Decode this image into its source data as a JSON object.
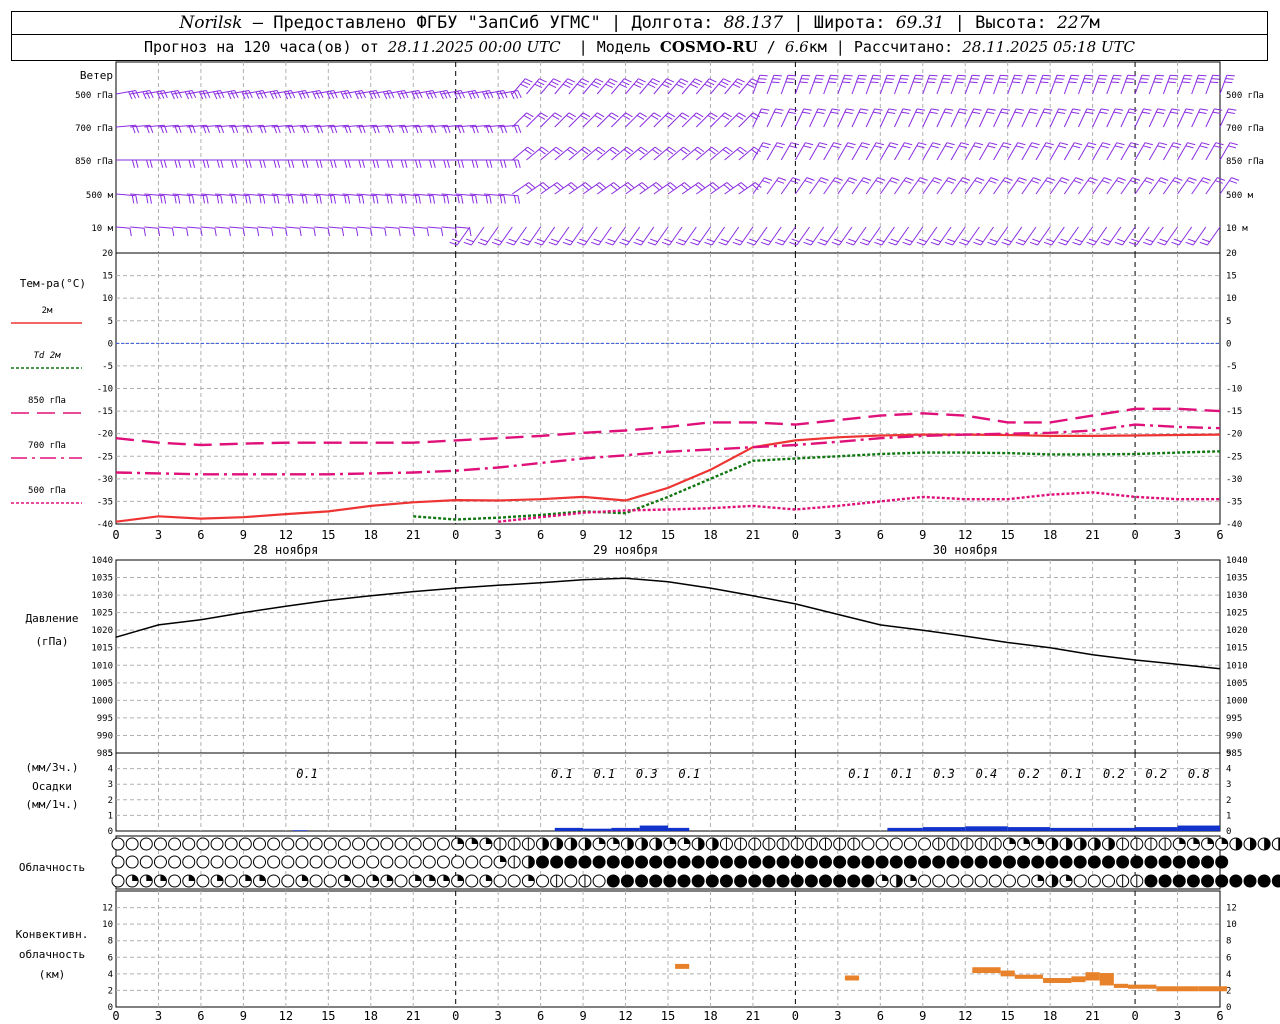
{
  "header": {
    "station": "Norilsk",
    "dash": "–",
    "provider": "Предоставлено ФГБУ \"ЗапСиб УГМС\"",
    "lon_label": "Долгота:",
    "lon": "88.137",
    "lat_label": "Широта:",
    "lat": "69.31",
    "alt_label": "Высота:",
    "alt": "227",
    "alt_unit": "м",
    "forecast_label": "Прогноз на 120 часа(ов) от",
    "forecast_start": "28.11.2025 00:00 UTC",
    "model_label": "Модель",
    "model": "COSMO-RU",
    "model_res": "6.6",
    "model_res_unit": "км",
    "computed_label": "Рассчитано:",
    "computed": "28.11.2025 05:18 UTC"
  },
  "chart_data": [
    {
      "type": "wind_barbs",
      "panel_label": "Ветер",
      "levels": [
        "500 гПа",
        "700 гПа",
        "850 гПа",
        "500 м",
        "10  м"
      ],
      "color": "#8a2be2"
    },
    {
      "type": "line",
      "panel_label": "Тем-ра(°C)",
      "ylim": [
        -40,
        20
      ],
      "yticks": [
        20,
        15,
        10,
        5,
        0,
        -5,
        -10,
        -15,
        -20,
        -25,
        -30,
        -35,
        -40
      ],
      "x_hours": [
        0,
        3,
        6,
        9,
        12,
        15,
        18,
        21,
        24,
        27,
        30,
        33,
        36,
        39,
        42,
        45,
        48,
        51,
        54,
        57,
        60,
        63,
        66,
        69,
        72,
        75,
        78
      ],
      "x_ticks": [
        "0",
        "3",
        "6",
        "9",
        "12",
        "15",
        "18",
        "21",
        "0",
        "3",
        "6",
        "9",
        "12",
        "15",
        "18",
        "21",
        "0",
        "3",
        "6",
        "9",
        "12",
        "15",
        "18",
        "21",
        "0",
        "3",
        "6"
      ],
      "dates": [
        "28 ноября",
        "29 ноября",
        "30 ноября"
      ],
      "series": [
        {
          "name": "2м",
          "color": "#ee3333",
          "dash": "solid",
          "values": [
            -39.5,
            -38.3,
            -38.8,
            -38.5,
            -37.8,
            -37.2,
            -36.0,
            -35.2,
            -34.7,
            -34.8,
            -34.5,
            -34.0,
            -34.8,
            -32.0,
            -28.0,
            -23.0,
            -21.5,
            -20.8,
            -20.4,
            -20.2,
            -20.2,
            -20.3,
            -20.5,
            -20.5,
            -20.4,
            -20.3,
            -20.2
          ]
        },
        {
          "name": "Td 2м",
          "color": "#117711",
          "dash": "dotted",
          "values": [
            null,
            null,
            null,
            null,
            null,
            null,
            null,
            -38.3,
            -39.0,
            -38.6,
            -38.0,
            -37.2,
            -37.6,
            -34.0,
            -30.0,
            -26.0,
            -25.5,
            -25.0,
            -24.5,
            -24.2,
            -24.2,
            -24.3,
            -24.6,
            -24.6,
            -24.5,
            -24.2,
            -23.9
          ]
        },
        {
          "name": "850 гПа",
          "color": "#e0107a",
          "dash": "longdash",
          "values": [
            -21.0,
            -22.0,
            -22.5,
            -22.2,
            -22.0,
            -22.0,
            -22.0,
            -22.0,
            -21.5,
            -21.0,
            -20.5,
            -19.8,
            -19.3,
            -18.5,
            -17.5,
            -17.5,
            -18.0,
            -17.0,
            -16.0,
            -15.5,
            -16.0,
            -17.5,
            -17.5,
            -16.0,
            -14.5,
            -14.5,
            -15.0
          ]
        },
        {
          "name": "700 гПа",
          "color": "#e0107a",
          "dash": "dashdot",
          "values": [
            -28.6,
            -28.8,
            -29.0,
            -29.0,
            -29.0,
            -29.0,
            -28.8,
            -28.6,
            -28.2,
            -27.5,
            -26.5,
            -25.5,
            -24.8,
            -24.0,
            -23.5,
            -23.0,
            -22.5,
            -21.8,
            -21.0,
            -20.5,
            -20.2,
            -20.0,
            -19.8,
            -19.3,
            -18.0,
            -18.5,
            -18.8
          ]
        },
        {
          "name": "500 гПа",
          "color": "#e0107a",
          "dash": "dotted",
          "values": [
            null,
            null,
            null,
            null,
            null,
            null,
            null,
            null,
            null,
            -39.5,
            -38.5,
            -37.5,
            -37.0,
            -36.8,
            -36.5,
            -36.0,
            -36.8,
            -36.0,
            -35.0,
            -34.0,
            -34.5,
            -34.5,
            -33.5,
            -33.0,
            -34.0,
            -34.5,
            -34.5
          ]
        }
      ]
    },
    {
      "type": "line",
      "panel_label": "Давление",
      "panel_unit": "(гПа)",
      "ylim": [
        985,
        1040
      ],
      "yticks": [
        1040,
        1035,
        1030,
        1025,
        1020,
        1015,
        1010,
        1005,
        1000,
        995,
        990,
        985
      ],
      "x_hours": [
        0,
        3,
        6,
        9,
        12,
        15,
        18,
        21,
        24,
        27,
        30,
        33,
        36,
        39,
        42,
        45,
        48,
        51,
        54,
        57,
        60,
        63,
        66,
        69,
        72,
        75,
        78
      ],
      "series": [
        {
          "name": "pressure",
          "color": "#000000",
          "values": [
            1018.0,
            1021.5,
            1023.0,
            1025.0,
            1026.8,
            1028.5,
            1029.8,
            1031.0,
            1032.0,
            1032.8,
            1033.5,
            1034.4,
            1034.8,
            1033.8,
            1032.0,
            1029.8,
            1027.5,
            1024.5,
            1021.5,
            1020.0,
            1018.3,
            1016.5,
            1015.0,
            1013.0,
            1011.5,
            1010.3,
            1009.0
          ]
        }
      ]
    },
    {
      "type": "bar",
      "panel_label": "Осадки",
      "panel_unit_top": "(мм/3ч.)",
      "panel_unit_bottom": "(мм/1ч.)",
      "ylim": [
        0,
        5
      ],
      "yticks": [
        5,
        4,
        3,
        2,
        1,
        0
      ],
      "color": "#1133cc",
      "bars_hours": [
        [
          12.5,
          13.5,
          0.05
        ],
        [
          31,
          33,
          0.2
        ],
        [
          33,
          35,
          0.15
        ],
        [
          35,
          37,
          0.2
        ],
        [
          37,
          39,
          0.35
        ],
        [
          39,
          40.5,
          0.2
        ],
        [
          54.5,
          57,
          0.2
        ],
        [
          57,
          60,
          0.25
        ],
        [
          60,
          63,
          0.3
        ],
        [
          63,
          66,
          0.25
        ],
        [
          66,
          69,
          0.2
        ],
        [
          69,
          72,
          0.2
        ],
        [
          72,
          75,
          0.25
        ],
        [
          75,
          78,
          0.35
        ]
      ],
      "labels_3h": [
        {
          "hour": 13.5,
          "text": "0.1"
        },
        {
          "hour": 31.5,
          "text": "0.1"
        },
        {
          "hour": 34.5,
          "text": "0.1"
        },
        {
          "hour": 37.5,
          "text": "0.3"
        },
        {
          "hour": 40.5,
          "text": "0.1"
        },
        {
          "hour": 52.5,
          "text": "0.1"
        },
        {
          "hour": 55.5,
          "text": "0.1"
        },
        {
          "hour": 58.5,
          "text": "0.3"
        },
        {
          "hour": 61.5,
          "text": "0.4"
        },
        {
          "hour": 64.5,
          "text": "0.2"
        },
        {
          "hour": 67.5,
          "text": "0.1"
        },
        {
          "hour": 70.5,
          "text": "0.2"
        },
        {
          "hour": 73.5,
          "text": "0.2"
        },
        {
          "hour": 76.5,
          "text": "0.8"
        }
      ]
    },
    {
      "type": "table",
      "panel_label": "Облачность",
      "rows": [
        {
          "name": "upper",
          "runs": [
            [
              24,
              0
            ],
            [
              3,
              2
            ],
            [
              3,
              1
            ],
            [
              4,
              3
            ],
            [
              2,
              2
            ],
            [
              3,
              3
            ],
            [
              2,
              2
            ],
            [
              2,
              3
            ],
            [
              10,
              1
            ],
            [
              5,
              0
            ],
            [
              5,
              1
            ],
            [
              3,
              2
            ],
            [
              5,
              3
            ],
            [
              4,
              1
            ],
            [
              4,
              2
            ],
            [
              4,
              3
            ]
          ]
        },
        {
          "name": "middle",
          "runs": [
            [
              27,
              0
            ],
            [
              1,
              2
            ],
            [
              1,
              1
            ],
            [
              1,
              3
            ],
            [
              49,
              4
            ]
          ]
        },
        {
          "name": "lower",
          "runs": [
            [
              1,
              0
            ],
            [
              3,
              2
            ],
            [
              1,
              0
            ],
            [
              1,
              2
            ],
            [
              1,
              0
            ],
            [
              1,
              2
            ],
            [
              1,
              0
            ],
            [
              2,
              2
            ],
            [
              2,
              0
            ],
            [
              1,
              2
            ],
            [
              2,
              0
            ],
            [
              1,
              2
            ],
            [
              1,
              0
            ],
            [
              2,
              2
            ],
            [
              1,
              0
            ],
            [
              4,
              2
            ],
            [
              1,
              0
            ],
            [
              1,
              2
            ],
            [
              2,
              0
            ],
            [
              1,
              2
            ],
            [
              1,
              0
            ],
            [
              1,
              1
            ],
            [
              1,
              0
            ],
            [
              1,
              1
            ],
            [
              1,
              0
            ],
            [
              19,
              4
            ],
            [
              1,
              2
            ],
            [
              1,
              3
            ],
            [
              1,
              2
            ],
            [
              8,
              0
            ],
            [
              1,
              2
            ],
            [
              1,
              3
            ],
            [
              1,
              2
            ],
            [
              3,
              0
            ],
            [
              2,
              1
            ],
            [
              10,
              4
            ],
            [
              1,
              2
            ],
            [
              10,
              4
            ]
          ]
        }
      ]
    },
    {
      "type": "bar",
      "panel_label_1": "Конвективн.",
      "panel_label_2": "облачность",
      "panel_label_3": "(км)",
      "ylim": [
        0,
        14
      ],
      "yticks": [
        12,
        10,
        8,
        6,
        4,
        2,
        0
      ],
      "color": "#e8822a",
      "segments": [
        [
          39.5,
          40.5,
          4.6,
          0.6
        ],
        [
          51.5,
          52.5,
          3.2,
          0.6
        ],
        [
          60.5,
          62.5,
          4.1,
          0.7
        ],
        [
          62.5,
          63.5,
          3.7,
          0.7
        ],
        [
          63.5,
          65.5,
          3.4,
          0.5
        ],
        [
          65.5,
          67.5,
          2.9,
          0.6
        ],
        [
          67.5,
          68.5,
          3.0,
          0.7
        ],
        [
          68.5,
          69.5,
          3.2,
          1.0
        ],
        [
          69.5,
          70.5,
          2.6,
          1.5
        ],
        [
          70.5,
          71.5,
          2.3,
          0.5
        ],
        [
          71.5,
          73.5,
          2.2,
          0.5
        ],
        [
          73.5,
          76.5,
          1.9,
          0.6
        ],
        [
          76.5,
          78.5,
          1.9,
          0.6
        ]
      ]
    }
  ]
}
